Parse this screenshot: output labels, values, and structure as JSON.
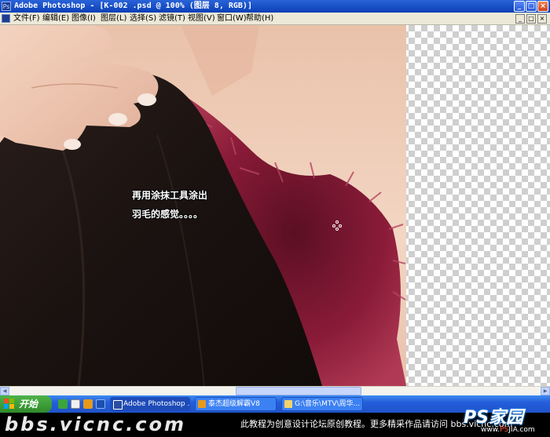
{
  "window": {
    "title": "Adobe Photoshop - [K-002 .psd @ 100% (图层 8, RGB)]",
    "minimize": "_",
    "maximize": "□",
    "close": "×"
  },
  "menu": {
    "items": [
      "文件(F)",
      "编辑(E)",
      "图像(I)",
      "图层(L)",
      "选择(S)",
      "滤镜(T)",
      "视图(V)",
      "窗口(W)",
      "帮助(H)"
    ]
  },
  "canvas": {
    "annotation_line1": "再用涂抹工具涂出",
    "annotation_line2": "羽毛的感觉。。。。",
    "cursor_icon": "crosshair-cursor-icon"
  },
  "scrollbar": {
    "left_arrow": "◀",
    "right_arrow": "▶"
  },
  "taskbar": {
    "start_label": "开始",
    "tasks": [
      {
        "label": "Adobe Photoshop ...",
        "icon": "photoshop-icon",
        "color": "#2a4d9e"
      },
      {
        "label": "泰杰超级解霸V8",
        "icon": "media-player-icon",
        "color": "#e89a1c"
      },
      {
        "label": "G:\\音乐\\MTV\\周华...",
        "icon": "folder-icon",
        "color": "#f2d36b"
      }
    ]
  },
  "footer": {
    "site": "bbs.vicnc.com",
    "note": "此教程为创意设计论坛原创教程。更多精采作品请访问 bbs.vicnc.com",
    "logo_text": "PS家园",
    "logo_url_prefix": "www.",
    "logo_url_ps": "PS",
    "logo_url_rest": "JIA.com",
    "logo_color": "#1e7fe0"
  }
}
